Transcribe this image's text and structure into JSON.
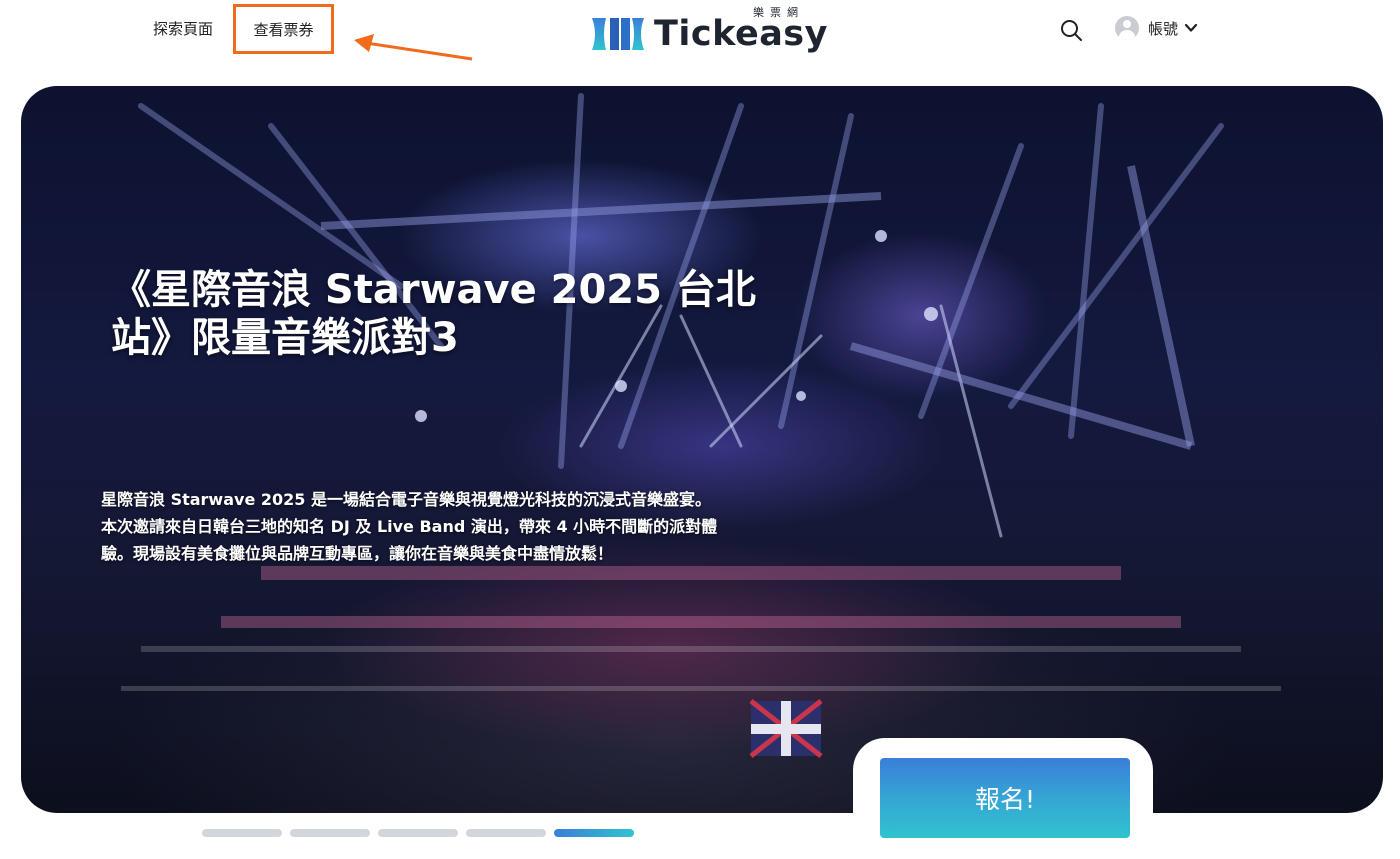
{
  "header": {
    "nav_explore": "探索頁面",
    "nav_tickets": "查看票券",
    "logo_text": "Tickeasy",
    "logo_sub": "樂票網",
    "account_label": "帳號"
  },
  "icons": {
    "search": "search-icon",
    "avatar": "user-avatar-icon",
    "chevron": "chevron-down-icon",
    "annotation_arrow": "arrow-left-icon"
  },
  "colors": {
    "highlight_border": "#f26a1b",
    "brand_teal": "#2fc3cf",
    "brand_blue": "#3a7fd8",
    "dot_inactive": "#d3d6db"
  },
  "hero": {
    "title_line1": "《星際音浪 Starwave 2025 台北",
    "title_line2": "站》限量音樂派對3",
    "desc_line1": "星際音浪 Starwave 2025 是一場結合電子音樂與視覺燈光科技的沉浸式音樂盛宴。",
    "desc_line2": "本次邀請來自日韓台三地的知名 DJ 及 Live Band 演出，帶來 4 小時不間斷的派對體",
    "desc_line3": "驗。現場設有美食攤位與品牌互動專區，讓你在音樂與美食中盡情放鬆！",
    "register_label": "報名!"
  },
  "carousel": {
    "slide_count": 5,
    "active_index": 4
  }
}
